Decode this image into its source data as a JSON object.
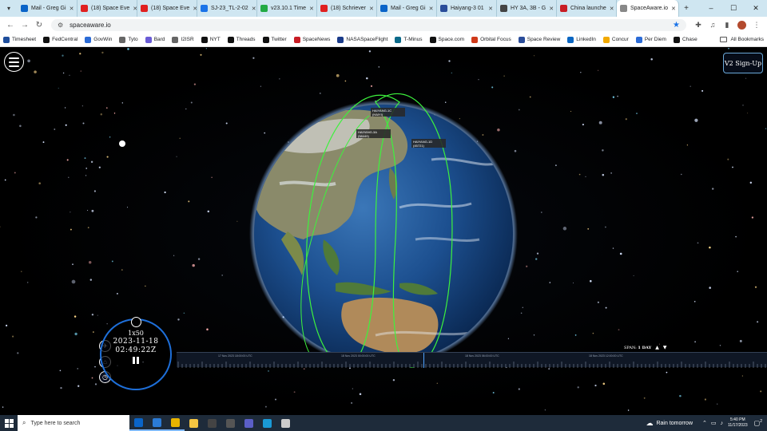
{
  "browser": {
    "tabs": [
      {
        "title": "Mail - Greg Gi",
        "color": "#0a64c8"
      },
      {
        "title": "(18) Space Eve",
        "color": "#e02020"
      },
      {
        "title": "(18) Space Eve",
        "color": "#e02020"
      },
      {
        "title": "SJ-23_TL-2-02",
        "color": "#1a73e8"
      },
      {
        "title": "v23.10.1 Time",
        "color": "#22aa44"
      },
      {
        "title": "(18) Schriever",
        "color": "#e02020"
      },
      {
        "title": "Mail - Greg Gi",
        "color": "#0a64c8"
      },
      {
        "title": "Haiyang-3 01",
        "color": "#2a4d9a"
      },
      {
        "title": "HY 3A, 3B - G",
        "color": "#444444"
      },
      {
        "title": "China launche",
        "color": "#c81d25"
      },
      {
        "title": "SpaceAware.io",
        "color": "#888888"
      }
    ],
    "active_tab": 10,
    "new_tab": "+",
    "window_controls": [
      "–",
      "☐",
      "✕"
    ],
    "nav": {
      "back": "←",
      "forward": "→",
      "reload": "↻"
    },
    "url": "spaceaware.io",
    "star": "★",
    "icons": [
      "puzzle-icon",
      "media-icon",
      "sidepanel-icon",
      "menu-dots-icon"
    ],
    "bookmarks": [
      {
        "label": "Timesheet",
        "color": "#1f4e9c"
      },
      {
        "label": "FedCentral",
        "color": "#111111"
      },
      {
        "label": "GovWin",
        "color": "#2b6bd6"
      },
      {
        "label": "Tyto",
        "color": "#666666"
      },
      {
        "label": "Bard",
        "color": "#6a5cd6"
      },
      {
        "label": "I2ISR",
        "color": "#666666"
      },
      {
        "label": "NYT",
        "color": "#111111"
      },
      {
        "label": "Threads",
        "color": "#111111"
      },
      {
        "label": "Twitter",
        "color": "#111111"
      },
      {
        "label": "SpaceNews",
        "color": "#c81d25"
      },
      {
        "label": "NASASpaceFlight",
        "color": "#1a3b8a"
      },
      {
        "label": "T-Minus",
        "color": "#0b6a8a"
      },
      {
        "label": "Space.com",
        "color": "#111111"
      },
      {
        "label": "Orbital Focus",
        "color": "#d03a1a"
      },
      {
        "label": "Space Review",
        "color": "#2a4d9a"
      },
      {
        "label": "LinkedIn",
        "color": "#0a66c2"
      },
      {
        "label": "Concur",
        "color": "#f2a900"
      },
      {
        "label": "Per Diem",
        "color": "#2b6bd6"
      },
      {
        "label": "Chase",
        "color": "#111111"
      }
    ],
    "all_bookmarks": "All Bookmarks"
  },
  "app": {
    "signup_label": "V2 Sign-Up",
    "satellites": [
      {
        "name": "HAIYANG-1C",
        "id": "(HAIYI)"
      },
      {
        "name": "HAIYANG-3A",
        "id": "(58449)"
      },
      {
        "name": "HAIYANG-1D",
        "id": "(45721)"
      }
    ],
    "clock": {
      "multiplier": "1x50",
      "date": "2023-11-18",
      "time": "02:49:22Z"
    },
    "timeline": {
      "labels": [
        "17 Nov 2023 18:00:00 UTC",
        "18 Nov 2023 00:00:00 UTC",
        "18 Nov 2023 06:00:00 UTC",
        "18 Nov 2023 12:00:00 UTC"
      ],
      "span_label": "SPAN:",
      "span_value": "1 DAY"
    }
  },
  "taskbar": {
    "search_placeholder": "Type here to search",
    "apps": [
      {
        "name": "outlook-app",
        "color": "#0a64c8"
      },
      {
        "name": "app-s",
        "color": "#2b7bd6"
      },
      {
        "name": "chrome-app",
        "color": "#e8b400"
      },
      {
        "name": "explorer-app",
        "color": "#f4c542"
      },
      {
        "name": "store-app",
        "color": "#444444"
      },
      {
        "name": "calculator-app",
        "color": "#555555"
      },
      {
        "name": "teams-app",
        "color": "#5b5fc7"
      },
      {
        "name": "app-c",
        "color": "#1a9ad6"
      },
      {
        "name": "app-chat",
        "color": "#cccccc"
      }
    ],
    "weather": "Rain tomorrow",
    "time": "5:40 PM",
    "date": "11/17/2023",
    "notifications": "2"
  }
}
